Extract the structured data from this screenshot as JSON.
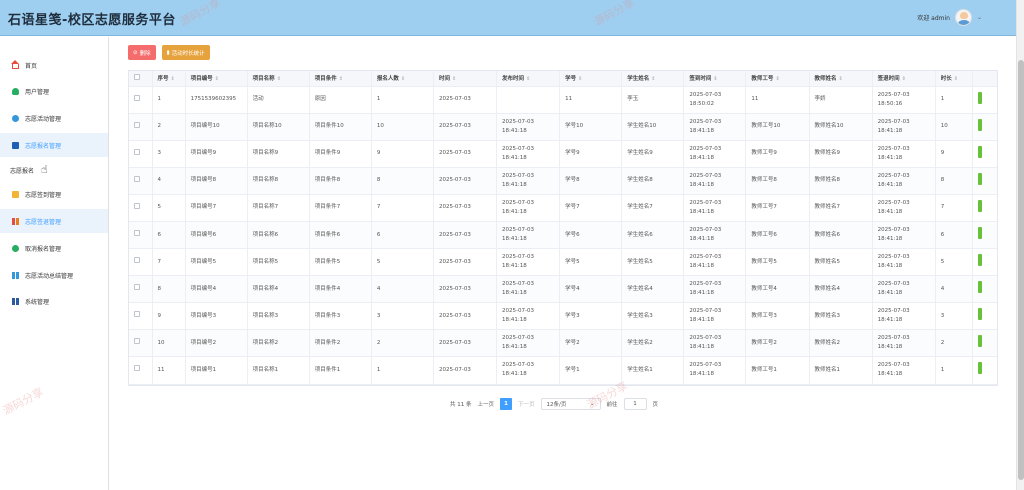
{
  "header": {
    "title": "石语星笺-校区志愿服务平台",
    "welcome": "欢迎 admin",
    "caret": "⌄"
  },
  "sidebar": {
    "items": [
      {
        "label": "首页",
        "icon": "home-icon"
      },
      {
        "label": "用户管理",
        "icon": "user-icon"
      },
      {
        "label": "志愿活动管理",
        "icon": "activity-icon"
      },
      {
        "label": "志愿报名管理",
        "icon": "card-icon"
      },
      {
        "label": "志愿签到管理",
        "icon": "checkin-icon"
      },
      {
        "label": "志愿签退管理",
        "icon": "checkout-icon"
      },
      {
        "label": "取消报名管理",
        "icon": "cancel-icon"
      },
      {
        "label": "志愿活动总结管理",
        "icon": "summary-icon"
      },
      {
        "label": "系统管理",
        "icon": "system-icon"
      }
    ],
    "hover_label": "志愿报名"
  },
  "toolbar": {
    "delete_label": "删除",
    "stat_label": "活动时长统计"
  },
  "table": {
    "headers": [
      "序号",
      "项目编号",
      "项目名称",
      "项目条件",
      "报名人数",
      "时间",
      "发布时间",
      "学号",
      "学生姓名",
      "签到时间",
      "教师工号",
      "教师姓名",
      "签退时间",
      "时长"
    ],
    "rows": [
      [
        "1",
        "1751539602395",
        "活动",
        "原因",
        "1",
        "2025-07-03",
        "",
        "11",
        "李玉",
        "2025-07-03 18:50:02",
        "11",
        "李娇",
        "2025-07-03 18:50:16",
        "1"
      ],
      [
        "2",
        "项目编号10",
        "项目名称10",
        "项目条件10",
        "10",
        "2025-07-03",
        "2025-07-03 18:41:18",
        "学号10",
        "学生姓名10",
        "2025-07-03 18:41:18",
        "教师工号10",
        "教师姓名10",
        "2025-07-03 18:41:18",
        "10"
      ],
      [
        "3",
        "项目编号9",
        "项目名称9",
        "项目条件9",
        "9",
        "2025-07-03",
        "2025-07-03 18:41:18",
        "学号9",
        "学生姓名9",
        "2025-07-03 18:41:18",
        "教师工号9",
        "教师姓名9",
        "2025-07-03 18:41:18",
        "9"
      ],
      [
        "4",
        "项目编号8",
        "项目名称8",
        "项目条件8",
        "8",
        "2025-07-03",
        "2025-07-03 18:41:18",
        "学号8",
        "学生姓名8",
        "2025-07-03 18:41:18",
        "教师工号8",
        "教师姓名8",
        "2025-07-03 18:41:18",
        "8"
      ],
      [
        "5",
        "项目编号7",
        "项目名称7",
        "项目条件7",
        "7",
        "2025-07-03",
        "2025-07-03 18:41:18",
        "学号7",
        "学生姓名7",
        "2025-07-03 18:41:18",
        "教师工号7",
        "教师姓名7",
        "2025-07-03 18:41:18",
        "7"
      ],
      [
        "6",
        "项目编号6",
        "项目名称6",
        "项目条件6",
        "6",
        "2025-07-03",
        "2025-07-03 18:41:18",
        "学号6",
        "学生姓名6",
        "2025-07-03 18:41:18",
        "教师工号6",
        "教师姓名6",
        "2025-07-03 18:41:18",
        "6"
      ],
      [
        "7",
        "项目编号5",
        "项目名称5",
        "项目条件5",
        "5",
        "2025-07-03",
        "2025-07-03 18:41:18",
        "学号5",
        "学生姓名5",
        "2025-07-03 18:41:18",
        "教师工号5",
        "教师姓名5",
        "2025-07-03 18:41:18",
        "5"
      ],
      [
        "8",
        "项目编号4",
        "项目名称4",
        "项目条件4",
        "4",
        "2025-07-03",
        "2025-07-03 18:41:18",
        "学号4",
        "学生姓名4",
        "2025-07-03 18:41:18",
        "教师工号4",
        "教师姓名4",
        "2025-07-03 18:41:18",
        "4"
      ],
      [
        "9",
        "项目编号3",
        "项目名称3",
        "项目条件3",
        "3",
        "2025-07-03",
        "2025-07-03 18:41:18",
        "学号3",
        "学生姓名3",
        "2025-07-03 18:41:18",
        "教师工号3",
        "教师姓名3",
        "2025-07-03 18:41:18",
        "3"
      ],
      [
        "10",
        "项目编号2",
        "项目名称2",
        "项目条件2",
        "2",
        "2025-07-03",
        "2025-07-03 18:41:18",
        "学号2",
        "学生姓名2",
        "2025-07-03 18:41:18",
        "教师工号2",
        "教师姓名2",
        "2025-07-03 18:41:18",
        "2"
      ],
      [
        "11",
        "项目编号1",
        "项目名称1",
        "项目条件1",
        "1",
        "2025-07-03",
        "2025-07-03 18:41:18",
        "学号1",
        "学生姓名1",
        "2025-07-03 18:41:18",
        "教师工号1",
        "教师姓名1",
        "2025-07-03 18:41:18",
        "1"
      ]
    ]
  },
  "pagination": {
    "total_text": "共 11 条",
    "prev_label": "上一页",
    "current_page": "1",
    "next_label": "下一页",
    "page_size": "12条/页",
    "goto_label": "前往",
    "goto_value": "1",
    "page_unit": "页"
  },
  "watermark": {
    "text": "源码分享"
  },
  "colors": {
    "header_bg": "#9ecff0",
    "active_bg": "#eaf3fc",
    "primary": "#409eff",
    "danger": "#f56c6c",
    "warning": "#e6a23c",
    "success": "#67c23a"
  }
}
